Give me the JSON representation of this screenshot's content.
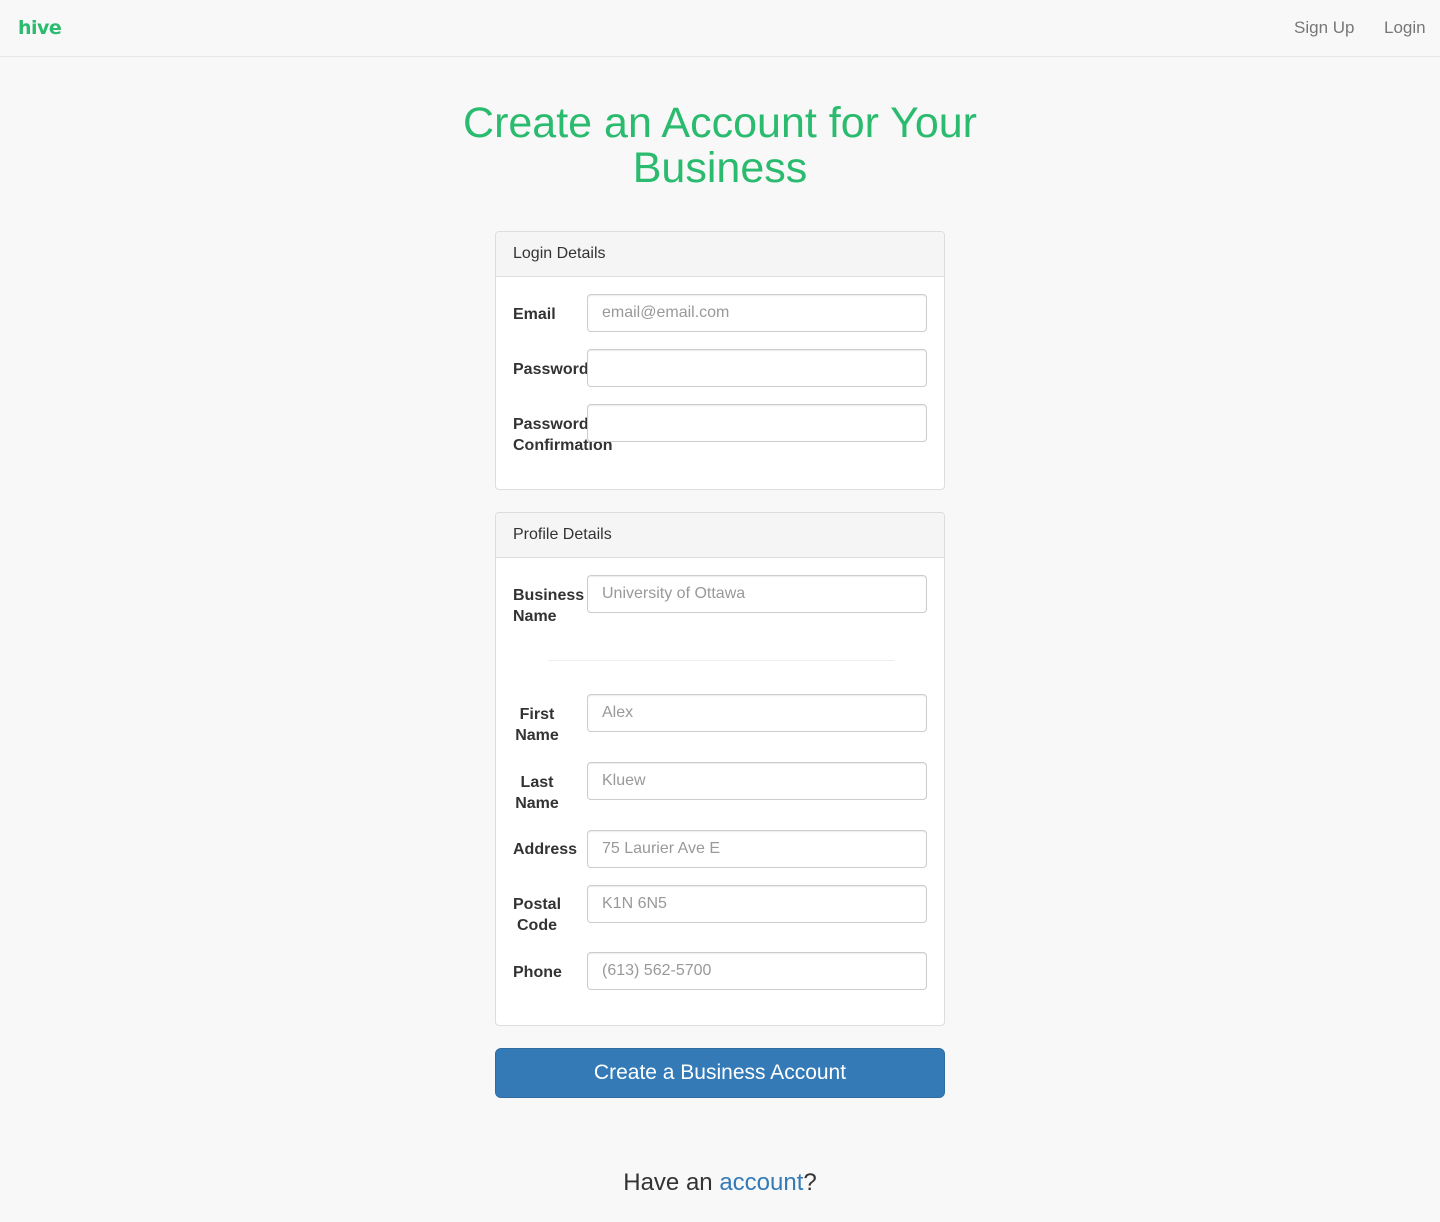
{
  "colors": {
    "brand_green": "#2abb6f",
    "primary_blue": "#337ab7",
    "link_blue": "#337ab7"
  },
  "navbar": {
    "brand": "hive",
    "links": [
      "Sign Up",
      "Login"
    ]
  },
  "page": {
    "title": "Create an Account for Your Business"
  },
  "login_details": {
    "heading": "Login Details",
    "email": {
      "label": "Email",
      "placeholder": "email@email.com",
      "value": ""
    },
    "password": {
      "label": "Password",
      "placeholder": "",
      "value": ""
    },
    "password_confirmation": {
      "label": "Password Confirmation",
      "placeholder": "",
      "value": ""
    }
  },
  "profile_details": {
    "heading": "Profile Details",
    "business_name": {
      "label": "Business Name",
      "placeholder": "University of Ottawa",
      "value": ""
    },
    "first_name": {
      "label": "First Name",
      "placeholder": "Alex",
      "value": ""
    },
    "last_name": {
      "label": "Last Name",
      "placeholder": "Kluew",
      "value": ""
    },
    "address": {
      "label": "Address",
      "placeholder": "75 Laurier Ave E",
      "value": ""
    },
    "postal_code": {
      "label": "Postal Code",
      "placeholder": "K1N 6N5",
      "value": ""
    },
    "phone": {
      "label": "Phone",
      "placeholder": "(613) 562-5700",
      "value": ""
    }
  },
  "submit": {
    "label": "Create a Business Account"
  },
  "footer": {
    "prefix": "Have an ",
    "link_text": "account",
    "suffix": "?"
  }
}
